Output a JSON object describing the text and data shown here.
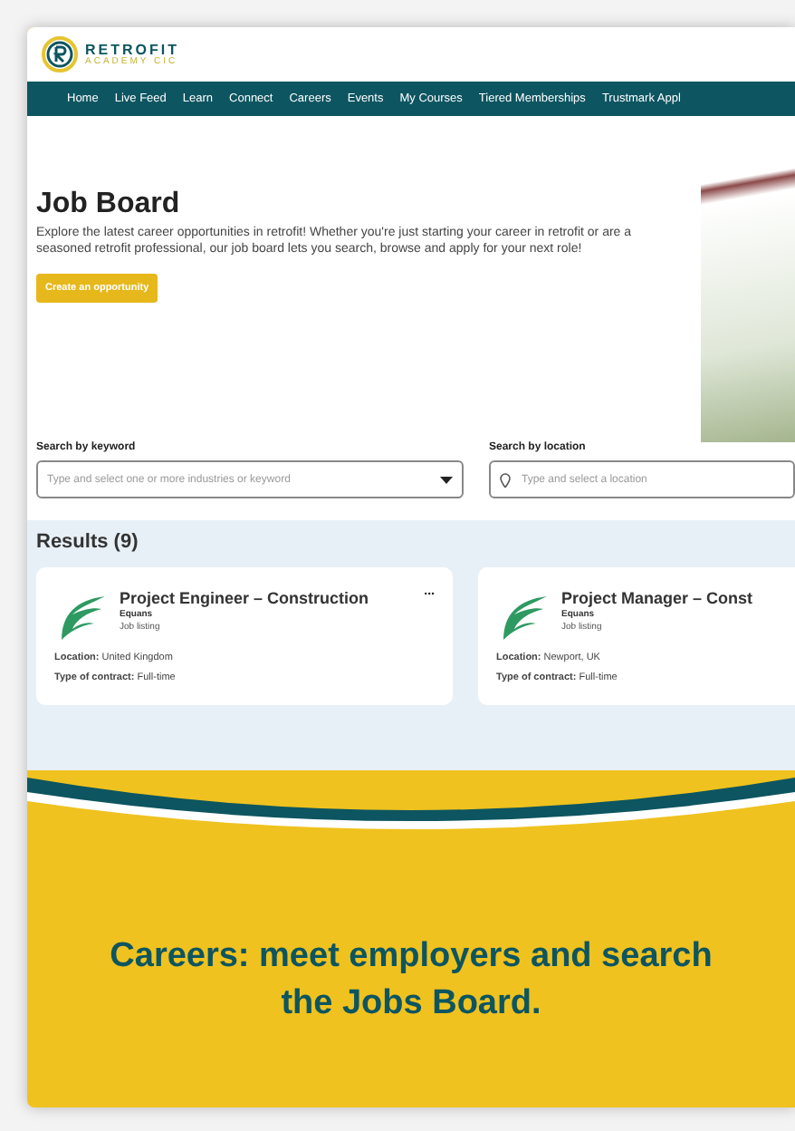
{
  "logo": {
    "name": "RETROFIT",
    "sub": "ACADEMY CIC"
  },
  "nav": [
    "Home",
    "Live Feed",
    "Learn",
    "Connect",
    "Careers",
    "Events",
    "My Courses",
    "Tiered Memberships",
    "Trustmark Appl"
  ],
  "hero": {
    "title": "Job Board",
    "text": "Explore the latest career opportunities in retrofit! Whether you're just starting your career in retrofit or are a seasoned retrofit professional, our job board lets you search, browse and apply for your next role!",
    "button": "Create an opportunity"
  },
  "search": [
    {
      "kind": "dropdown",
      "label": "Search by keyword",
      "placeholder": "Type and select one or more industries or keyword"
    },
    {
      "kind": "location",
      "label": "Search by location",
      "placeholder": "Type and select a location"
    }
  ],
  "results": {
    "title": "Results (9)",
    "jobs": [
      {
        "title": "Project Engineer – Construction",
        "company": "Equans",
        "type": "Job listing",
        "location_label": "Location:",
        "location": "United Kingdom",
        "contract_label": "Type of contract:",
        "contract": "Full-time",
        "menu": "..."
      },
      {
        "title": "Project Manager – Const",
        "company": "Equans",
        "type": "Job listing",
        "location_label": "Location:",
        "location": "Newport, UK",
        "contract_label": "Type of contract:",
        "contract": "Full-time"
      }
    ]
  },
  "caption": "Careers: meet employers and search the Jobs Board."
}
